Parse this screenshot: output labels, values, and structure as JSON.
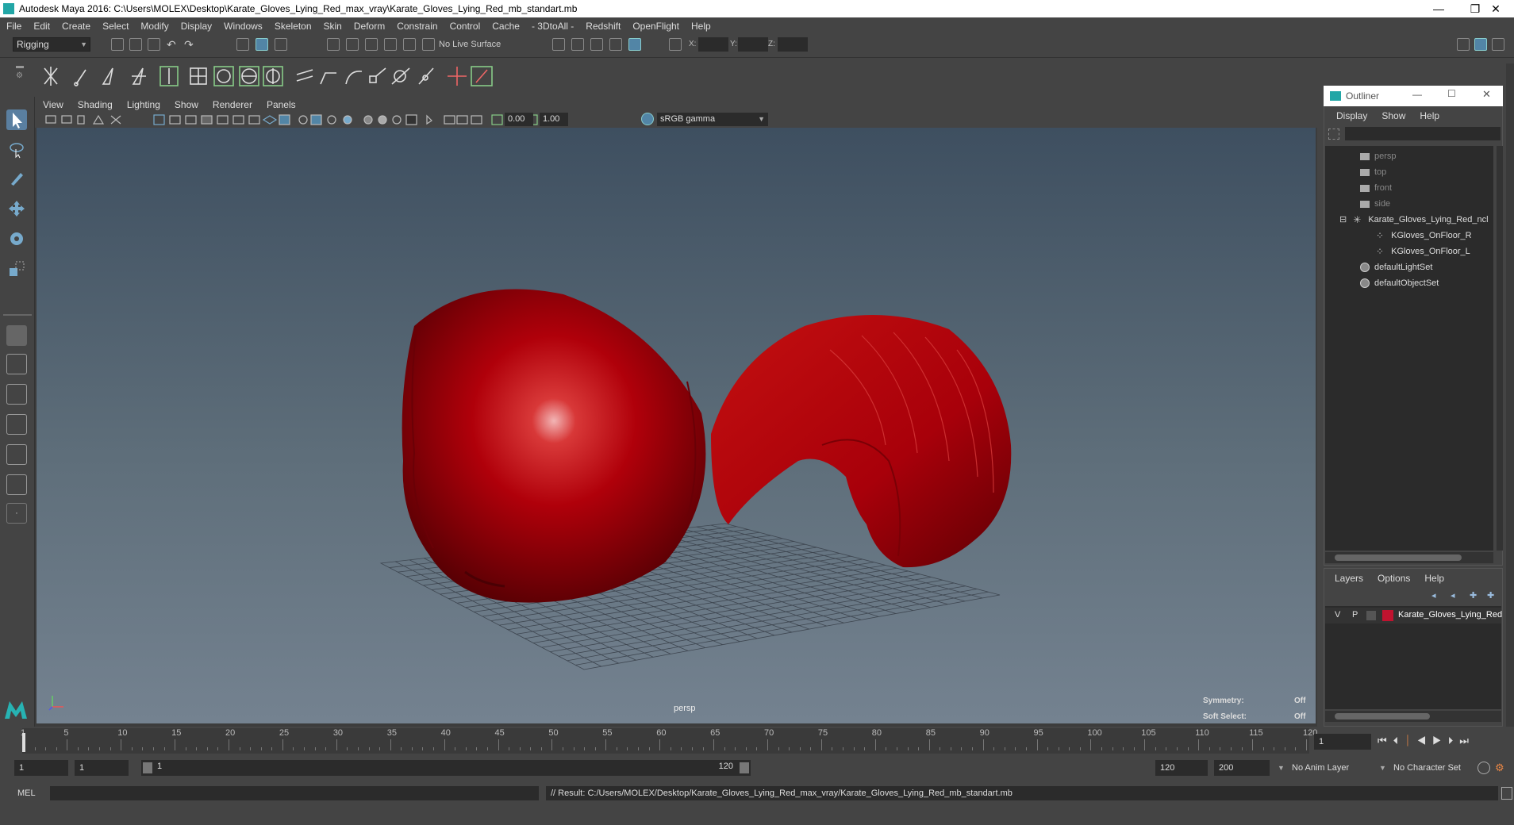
{
  "title_bar": {
    "title": "Autodesk Maya 2016: C:\\Users\\MOLEX\\Desktop\\Karate_Gloves_Lying_Red_max_vray\\Karate_Gloves_Lying_Red_mb_standart.mb",
    "minimize": "—",
    "maximize": "❐",
    "close": "✕"
  },
  "menu": [
    "File",
    "Edit",
    "Create",
    "Select",
    "Modify",
    "Display",
    "Windows",
    "Skeleton",
    "Skin",
    "Deform",
    "Constrain",
    "Control",
    "Cache",
    "- 3DtoAll -",
    "Redshift",
    "OpenFlight",
    "Help"
  ],
  "status_line": {
    "mode": "Rigging",
    "live_surface": "No Live Surface",
    "x_label": "X:",
    "y_label": "Y:",
    "z_label": "Z:"
  },
  "viewport": {
    "menu": [
      "View",
      "Shading",
      "Lighting",
      "Show",
      "Renderer",
      "Panels"
    ],
    "exposure": "0.00",
    "gamma_value": "1.00",
    "color_space": "sRGB gamma",
    "camera": "persp",
    "hud": {
      "symmetry_label": "Symmetry:",
      "symmetry_value": "Off",
      "soft_select_label": "Soft Select:",
      "soft_select_value": "Off"
    }
  },
  "outliner": {
    "title": "Outliner",
    "menu": [
      "Display",
      "Show",
      "Help"
    ],
    "items": [
      {
        "label": "persp",
        "type": "camera",
        "dim": true
      },
      {
        "label": "top",
        "type": "camera",
        "dim": true
      },
      {
        "label": "front",
        "type": "camera",
        "dim": true
      },
      {
        "label": "side",
        "type": "camera",
        "dim": true
      },
      {
        "label": "Karate_Gloves_Lying_Red_ncl",
        "type": "group",
        "expand": "⊟"
      },
      {
        "label": "KGloves_OnFloor_R",
        "type": "mesh"
      },
      {
        "label": "KGloves_OnFloor_L",
        "type": "mesh"
      },
      {
        "label": "defaultLightSet",
        "type": "set"
      },
      {
        "label": "defaultObjectSet",
        "type": "set"
      }
    ]
  },
  "layers": {
    "menu": [
      "Layers",
      "Options",
      "Help"
    ],
    "row": {
      "v": "V",
      "p": "P",
      "name": "Karate_Gloves_Lying_Red",
      "color": "#c0132f"
    }
  },
  "time_slider": {
    "ticks": [
      "1",
      "5",
      "10",
      "15",
      "20",
      "25",
      "30",
      "35",
      "40",
      "45",
      "50",
      "55",
      "60",
      "65",
      "70",
      "75",
      "80",
      "85",
      "90",
      "95",
      "100",
      "105",
      "110",
      "115",
      "120"
    ],
    "current_frame": "1"
  },
  "range": {
    "start": "1",
    "playback_start": "1",
    "slider_start": "1",
    "slider_end": "120",
    "playback_end": "120",
    "end": "200",
    "anim_layer": "No Anim Layer",
    "character_set": "No Character Set"
  },
  "command_line": {
    "lang": "MEL",
    "result": "// Result: C:/Users/MOLEX/Desktop/Karate_Gloves_Lying_Red_max_vray/Karate_Gloves_Lying_Red_mb_standart.mb"
  },
  "colors": {
    "glove_red": "#b0000a",
    "accent": "#5285a6"
  }
}
